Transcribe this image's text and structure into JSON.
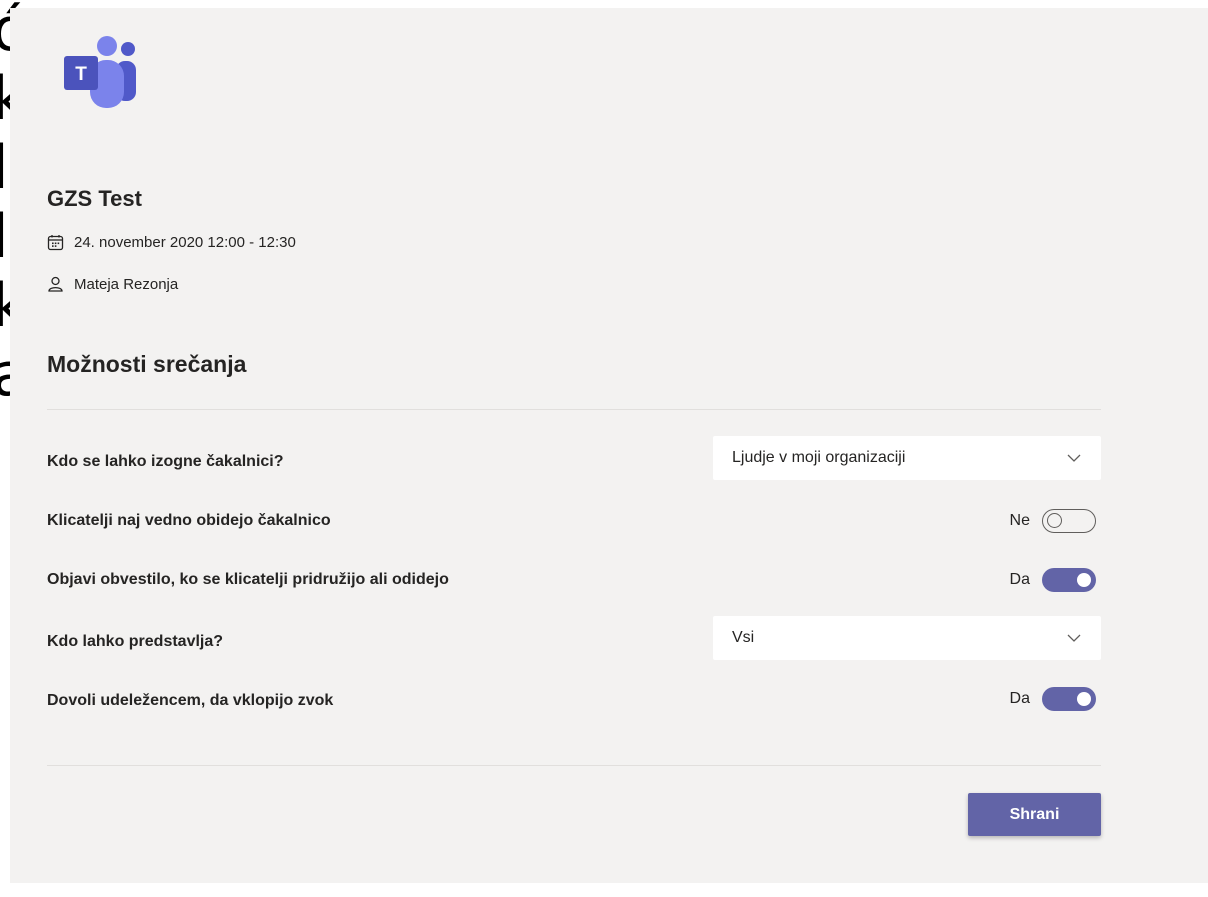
{
  "background_fragments": [
    "ó",
    "k",
    "l",
    "l",
    "k",
    "a"
  ],
  "app": {
    "logo_icon": "microsoft-teams-logo"
  },
  "meeting": {
    "title": "GZS Test",
    "datetime": "24. november 2020 12:00 - 12:30",
    "organizer": "Mateja Rezonja"
  },
  "options": {
    "heading": "Možnosti srečanja",
    "bypass_lobby": {
      "label": "Kdo se lahko izogne čakalnici?",
      "value": "Ljudje v moji organizaciji"
    },
    "callers_lobby": {
      "label": "Klicatelji naj vedno obidejo čakalnico",
      "state": "Ne",
      "on": false
    },
    "announce": {
      "label": "Objavi obvestilo, ko se klicatelji pridružijo ali odidejo",
      "state": "Da",
      "on": true
    },
    "presenters": {
      "label": "Kdo lahko predstavlja?",
      "value": "Vsi"
    },
    "unmute": {
      "label": "Dovoli udeležencem, da vklopijo zvok",
      "state": "Da",
      "on": true
    }
  },
  "actions": {
    "save_label": "Shrani"
  },
  "colors": {
    "accent": "#6264a7",
    "panel": "#f3f2f1"
  }
}
